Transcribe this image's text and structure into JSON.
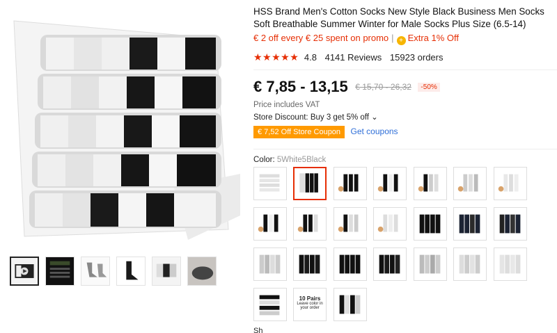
{
  "product": {
    "title": "HSS Brand Men's Cotton Socks New Style Black Business Men Socks Soft Breathable Summer Winter for Male Socks Plus Size (6.5-14)",
    "promo_text": "€ 2 off every € 25 spent on promo",
    "promo_separator": "|",
    "extra_icon": "+",
    "extra_text": "Extra 1% Off",
    "stars": "★★★★★",
    "rating": "4.8",
    "reviews": "4141 Reviews",
    "orders": "15923 orders",
    "price": "€ 7,85 - 13,15",
    "old_price": "€ 15,70 - 26,32",
    "discount": "-50%",
    "vat": "Price includes VAT",
    "store_discount": "Store Discount: Buy 3 get 5% off ⌄",
    "coupon": "€ 7,52 Off Store Coupon",
    "get_coupons": "Get coupons",
    "color_label": "Color:",
    "color_value": "5White5Black",
    "swatch_text_title": "10 Pairs",
    "swatch_text_sub": "Leave color in your order",
    "bottom_label": "Sh"
  },
  "colors": {
    "accent": "#e62e04",
    "coupon_bg": "#ff9a00",
    "link": "#2f6fd8"
  }
}
